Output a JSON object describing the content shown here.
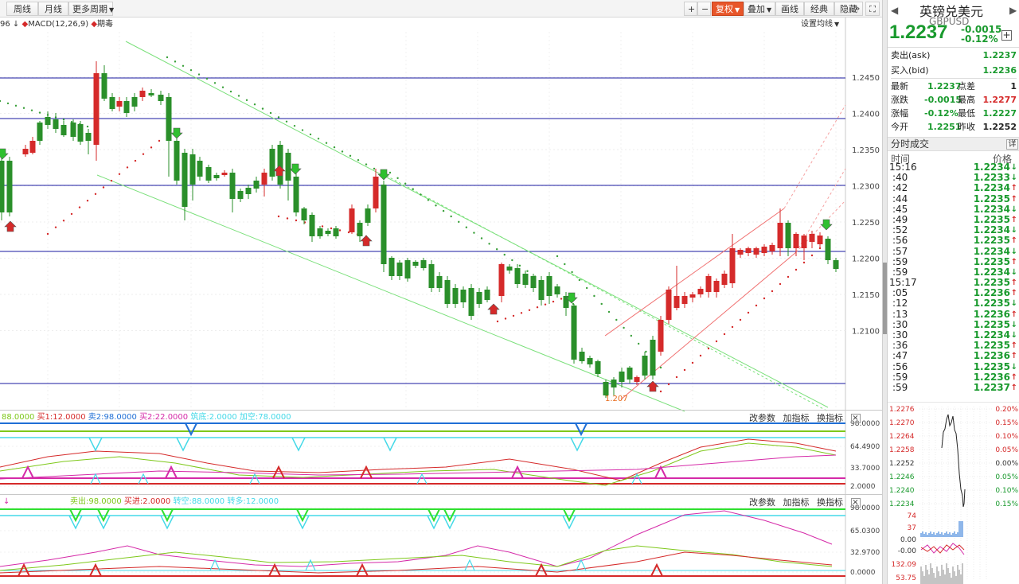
{
  "toolbar": {
    "week": "周线",
    "month": "月线",
    "more_period": "更多周期",
    "plus": "+",
    "minus": "−",
    "fuquan": "复权",
    "overlay": "叠加",
    "draw": "画线",
    "classic": "经典",
    "hide": "隐藏",
    "double_arrow": "»",
    "expand": "⛶"
  },
  "legend": {
    "truncated_number": "96",
    "macd": "MACD(12,26,9)",
    "period": "期毒",
    "set_ma": "设置均线"
  },
  "main_chart": {
    "price_axis": [
      "1.2450",
      "1.2400",
      "1.2350",
      "1.2300",
      "1.2250",
      "1.2200",
      "1.2150",
      "1.2100"
    ],
    "low_annotation": "1.207",
    "colors": {
      "up": "#d52a2a",
      "down": "#2a8f2a",
      "hline": "#1a1aa0"
    }
  },
  "panel1": {
    "legend": [
      {
        "text": "88.0000",
        "color": "#7ec81a"
      },
      {
        "text": "买1:12.0000",
        "color": "#d52a2a"
      },
      {
        "text": "卖2:98.0000",
        "color": "#1f6fd6"
      },
      {
        "text": "买2:22.0000",
        "color": "#d52aa8"
      },
      {
        "text": "筑底:2.0000",
        "color": "#45d9e8"
      },
      {
        "text": "加空:78.0000",
        "color": "#45d9e8"
      }
    ],
    "axis": [
      "98.0000",
      "64.4900",
      "33.7000",
      "2.0000"
    ]
  },
  "panel2": {
    "arrow": "↓",
    "legend": [
      {
        "text": "卖出:98.0000",
        "color": "#7ec81a"
      },
      {
        "text": "买进:2.0000",
        "color": "#d52a2a"
      },
      {
        "text": "转空:88.0000",
        "color": "#45d9e8"
      },
      {
        "text": "转多:12.0000",
        "color": "#45d9e8"
      }
    ],
    "axis": [
      "98.0000",
      "65.0300",
      "32.9700",
      "0.0000"
    ]
  },
  "panel_buttons": {
    "params": "改参数",
    "add": "加指标",
    "switch": "换指标",
    "close": "×"
  },
  "quote": {
    "name": "英镑兑美元",
    "code": "GBPUSD",
    "price": "1.2237",
    "change": "-0.0015",
    "change_pct": "-0.12%",
    "expand": "+",
    "prev_arrow": "◀",
    "next_arrow": "▶",
    "ask_label": "卖出(ask)",
    "ask": "1.2237",
    "bid_label": "买入(bid)",
    "bid": "1.2236",
    "latest_label": "最新",
    "latest": "1.2237",
    "spread_label": "点差",
    "spread": "1",
    "chg_label": "涨跌",
    "chg": "-0.0015",
    "high_label": "最高",
    "high": "1.2277",
    "pct_label": "涨幅",
    "pct": "-0.12%",
    "low_label": "最低",
    "low": "1.2227",
    "open_label": "今开",
    "open": "1.2251",
    "prev_label": "昨收",
    "prev_close": "1.2252"
  },
  "ticks": {
    "header": "分时成交",
    "detail": "详",
    "col_time": "时间",
    "col_price": "价格",
    "rows": [
      {
        "time": "15:16",
        "price": "1.2234",
        "dir": "down",
        "major": true
      },
      {
        "time": ":40",
        "price": "1.2233",
        "dir": "down"
      },
      {
        "time": ":42",
        "price": "1.2234",
        "dir": "up"
      },
      {
        "time": ":44",
        "price": "1.2235",
        "dir": "up"
      },
      {
        "time": ":45",
        "price": "1.2234",
        "dir": "down"
      },
      {
        "time": ":49",
        "price": "1.2235",
        "dir": "up"
      },
      {
        "time": ":52",
        "price": "1.2234",
        "dir": "down"
      },
      {
        "time": ":56",
        "price": "1.2235",
        "dir": "up"
      },
      {
        "time": ":57",
        "price": "1.2234",
        "dir": "down"
      },
      {
        "time": ":59",
        "price": "1.2235",
        "dir": "up"
      },
      {
        "time": ":59",
        "price": "1.2234",
        "dir": "down"
      },
      {
        "time": "15:17",
        "price": "1.2235",
        "dir": "up",
        "major": true
      },
      {
        "time": ":05",
        "price": "1.2236",
        "dir": "up"
      },
      {
        "time": ":12",
        "price": "1.2235",
        "dir": "down"
      },
      {
        "time": ":13",
        "price": "1.2236",
        "dir": "up"
      },
      {
        "time": ":30",
        "price": "1.2235",
        "dir": "down"
      },
      {
        "time": ":30",
        "price": "1.2234",
        "dir": "down"
      },
      {
        "time": ":36",
        "price": "1.2235",
        "dir": "up"
      },
      {
        "time": ":47",
        "price": "1.2236",
        "dir": "up"
      },
      {
        "time": ":56",
        "price": "1.2235",
        "dir": "down"
      },
      {
        "time": ":59",
        "price": "1.2236",
        "dir": "up"
      },
      {
        "time": ":59",
        "price": "1.2237",
        "dir": "up"
      }
    ]
  },
  "mini": {
    "left_axis": [
      "1.2276",
      "1.2270",
      "1.2264",
      "1.2258",
      "1.2252",
      "1.2246",
      "1.2240",
      "1.2234"
    ],
    "right_axis": [
      "0.20%",
      "0.15%",
      "0.10%",
      "0.05%",
      "0.00%",
      "0.05%",
      "0.10%",
      "0.15%"
    ],
    "vol_axis": [
      "74",
      "37",
      "0.00"
    ],
    "macd_axis": [
      "-0.00"
    ],
    "ind_axis": [
      "132.09",
      "53.75"
    ]
  }
}
